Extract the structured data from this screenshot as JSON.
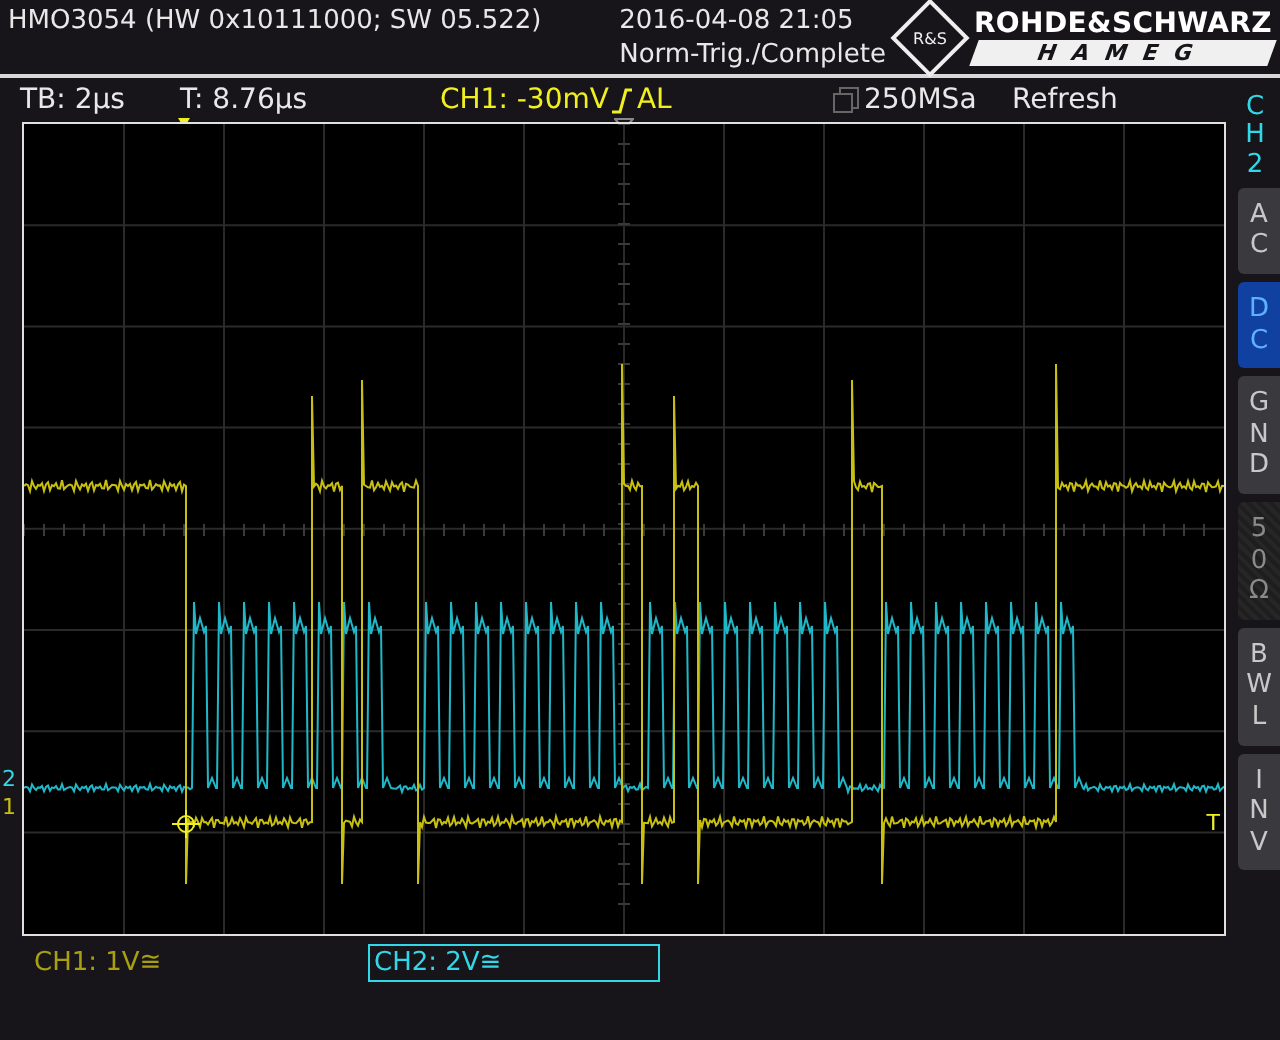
{
  "header": {
    "device": "HMO3054 (HW 0x10111000; SW 05.522)",
    "datetime": "2016-04-08 21:05",
    "status": "Norm-Trig./Complete",
    "logo_emblem": "R&S",
    "logo_brand": "ROHDE&SCHWARZ",
    "logo_sub": "HAMEG"
  },
  "info_bar": {
    "timebase": "TB: 2µs",
    "trigger_time": "T: 8.76µs",
    "trigger_level": "CH1: -30mV",
    "trigger_mode": "AL",
    "sample_rate": "250MSa",
    "acquisition": "Refresh"
  },
  "markers": {
    "ch2": "2",
    "ch1": "1",
    "trigger": "T"
  },
  "side_panel": {
    "channel": "CH2",
    "buttons": [
      {
        "label": "AC",
        "selected": false,
        "disabled": false
      },
      {
        "label": "DC",
        "selected": true,
        "disabled": false
      },
      {
        "label": "GND",
        "selected": false,
        "disabled": false
      },
      {
        "label": "50Ω",
        "selected": false,
        "disabled": true
      },
      {
        "label": "BWL",
        "selected": false,
        "disabled": false
      },
      {
        "label": "INV",
        "selected": false,
        "disabled": false
      }
    ]
  },
  "channels": [
    {
      "label": "CH1: 1V≅",
      "selected": false
    },
    {
      "label": "CH2: 2V≅",
      "selected": true
    }
  ]
}
